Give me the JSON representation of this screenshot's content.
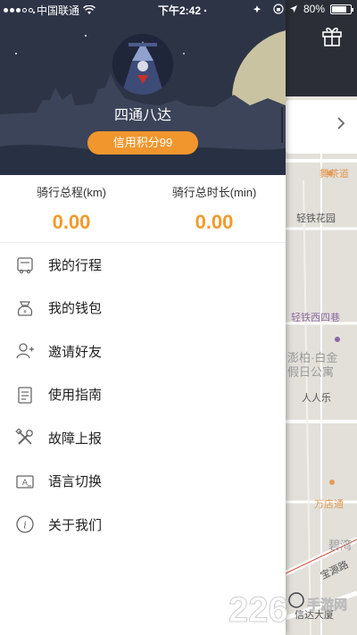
{
  "status_bar": {
    "carrier": "中国联通",
    "time": "下午2:42",
    "battery": "80%",
    "battery_level": 0.8
  },
  "profile": {
    "username": "四通八达",
    "credit_label": "信用积分99"
  },
  "stats": [
    {
      "label": "骑行总程(km)",
      "value": "0.00"
    },
    {
      "label": "骑行总时长(min)",
      "value": "0.00"
    }
  ],
  "menu": [
    {
      "label": "我的行程",
      "icon": "bike-icon"
    },
    {
      "label": "我的钱包",
      "icon": "wallet-icon"
    },
    {
      "label": "邀请好友",
      "icon": "invite-friend-icon"
    },
    {
      "label": "使用指南",
      "icon": "guide-book-icon"
    },
    {
      "label": "故障上报",
      "icon": "tools-icon"
    },
    {
      "label": "语言切换",
      "icon": "language-icon"
    },
    {
      "label": "关于我们",
      "icon": "info-icon"
    }
  ],
  "map": {
    "labels": [
      {
        "text": "舞茶道",
        "style": "orange"
      },
      {
        "text": "轻铁花园",
        "style": ""
      },
      {
        "text": "轻铁西四巷",
        "style": "purple"
      },
      {
        "text": "澎柏·白金",
        "style": "gray"
      },
      {
        "text": "假日公寓",
        "style": "gray"
      },
      {
        "text": "人人乐",
        "style": ""
      },
      {
        "text": "万店通",
        "style": "orange"
      },
      {
        "text": "碧湾",
        "style": "gray"
      },
      {
        "text": "宝源路",
        "style": ""
      },
      {
        "text": "信达大厦",
        "style": ""
      }
    ]
  },
  "watermark": {
    "number": "226",
    "text": "手游网"
  },
  "colors": {
    "accent": "#f0962d",
    "header_bg": "#2d3446",
    "stat_value": "#f39a2b"
  }
}
